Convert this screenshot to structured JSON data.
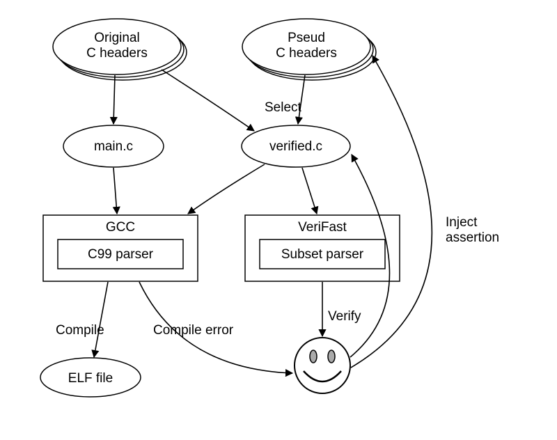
{
  "nodes": {
    "orig_headers": {
      "line1": "Original",
      "line2": "C headers"
    },
    "pseud_headers": {
      "line1": "Pseud",
      "line2": "C headers"
    },
    "main_c": "main.c",
    "verified_c": "verified.c",
    "gcc": {
      "title": "GCC",
      "inner": "C99 parser"
    },
    "verifast": {
      "title": "VeriFast",
      "inner": "Subset parser"
    },
    "elf": "ELF file"
  },
  "edges": {
    "select": "Select",
    "compile": "Compile",
    "compile_error": "Compile error",
    "verify": "Verify",
    "inject": {
      "line1": "Inject",
      "line2": "assertion"
    }
  }
}
